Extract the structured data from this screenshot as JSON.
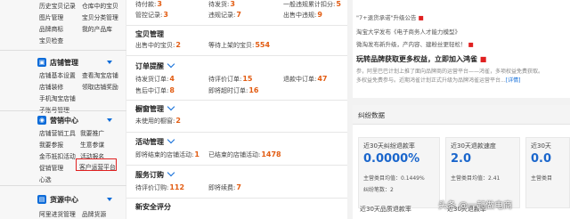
{
  "sidebar": {
    "top_rows": [
      [
        "历史宝贝记录",
        "仓库中的宝贝"
      ],
      [
        "图片管理",
        "宝贝分类管理"
      ],
      [
        "品牌商标",
        "我的产品库"
      ],
      [
        "宝贝检查",
        ""
      ]
    ],
    "shop_section": {
      "icon": "store-icon",
      "title": "店铺管理",
      "rows": [
        [
          "店铺基本设置",
          "查看淘宝店铺"
        ],
        [
          "店铺装修",
          "领取店铺奖励"
        ],
        [
          "手机淘宝店铺",
          ""
        ],
        [
          "子账号管理",
          ""
        ]
      ]
    },
    "marketing_section": {
      "icon": "marketing-icon",
      "title": "营销中心",
      "rows": [
        [
          "店铺营销工具",
          "我要推广"
        ],
        [
          "我要参报",
          "生意参谋"
        ],
        [
          "金币抵扣活动",
          "活动报名"
        ],
        [
          "促销管理",
          "客户运营平台"
        ],
        [
          "心选",
          ""
        ]
      ]
    },
    "supply_section": {
      "icon": "supply-icon",
      "title": "货源中心",
      "rows": [
        [
          "阿里进货管理",
          "品牌货源"
        ]
      ]
    }
  },
  "middle": {
    "top_stats_row1": [
      {
        "label": "待付款:",
        "value": "3"
      },
      {
        "label": "待发货:",
        "value": "3"
      },
      {
        "label": "一般违规累计扣分:",
        "value": "5"
      }
    ],
    "top_stats_row2": [
      {
        "label": "管控记录:",
        "value": "3"
      },
      {
        "label": "违规记录:",
        "value": "7"
      },
      {
        "label": "出售中违规:",
        "value": "9"
      }
    ],
    "baby_section": {
      "title": "宝贝管理",
      "stats": [
        {
          "label": "出售中的宝贝:",
          "value": "2"
        },
        {
          "label": "等待上架的宝贝:",
          "value": "554"
        }
      ]
    },
    "order_section": {
      "title": "订单提醒",
      "stats": [
        {
          "label": "待发货订单:",
          "value": "4"
        },
        {
          "label": "待评价订单:",
          "value": "15"
        },
        {
          "label": "退款中订单:",
          "value": "47"
        },
        {
          "label": "售后中订单:",
          "value": "8"
        },
        {
          "label": "即将超时订单:",
          "value": "16"
        }
      ]
    },
    "window_section": {
      "title": "橱窗管理",
      "stats": [
        {
          "label": "未使用的橱窗:",
          "value": "2"
        }
      ]
    },
    "activity_section": {
      "title": "活动管理",
      "stats": [
        {
          "label": "即将结束的店铺活动:",
          "value": "1"
        },
        {
          "label": "已结束的店铺活动:",
          "value": "1478"
        }
      ]
    },
    "service_section": {
      "title": "服务订购",
      "stats": [
        {
          "label": "待评价订购:",
          "value": "112"
        },
        {
          "label": "即将续费:",
          "value": "7"
        }
      ]
    },
    "newsafety_section": {
      "title": "新安全评分"
    }
  },
  "right": {
    "notice_lines": [
      "\"7+退货承诺\"升级公告",
      "淘宝大学发布《电子商务人才能力模型》",
      "微淘发布新升级，产内容、建粉丝更轻松！"
    ],
    "headline": "玩转品牌获取更多权益，立即加入鸿雀",
    "headline_desc_1": "参，阿里巴巴计划上推了面向品牌商的运营平台——鸿雀，多项权益免费获取。",
    "headline_desc_2": "多权益免费参与。近期鸿雀计划正式升级为品牌鸿雀运营平台...",
    "headline_more": "[详情]",
    "dispute": {
      "title": "纠纷数据",
      "cards": [
        {
          "label": "近30天纠纷退款率",
          "value": "0.0000%",
          "sub1": "主营类目均值：0.1449%",
          "sub2": "纠纷笔数：2"
        },
        {
          "label": "近30天退款速度",
          "value": "2.0",
          "sub1": "主营类目均值：2.41",
          "sub2": ""
        },
        {
          "label": "近30天",
          "value": "0.0",
          "sub1": "主营类目",
          "sub2": ""
        }
      ],
      "bottom_labels": [
        "近30天品质退款率",
        "近30天退款率",
        ""
      ]
    }
  },
  "watermark": "头条 @一起做电商",
  "colors": {
    "accent_blue": "#0e6cd9",
    "value_orange": "#e25c12",
    "highlight_red": "#e02020",
    "card_value_blue": "#1a66cc"
  }
}
